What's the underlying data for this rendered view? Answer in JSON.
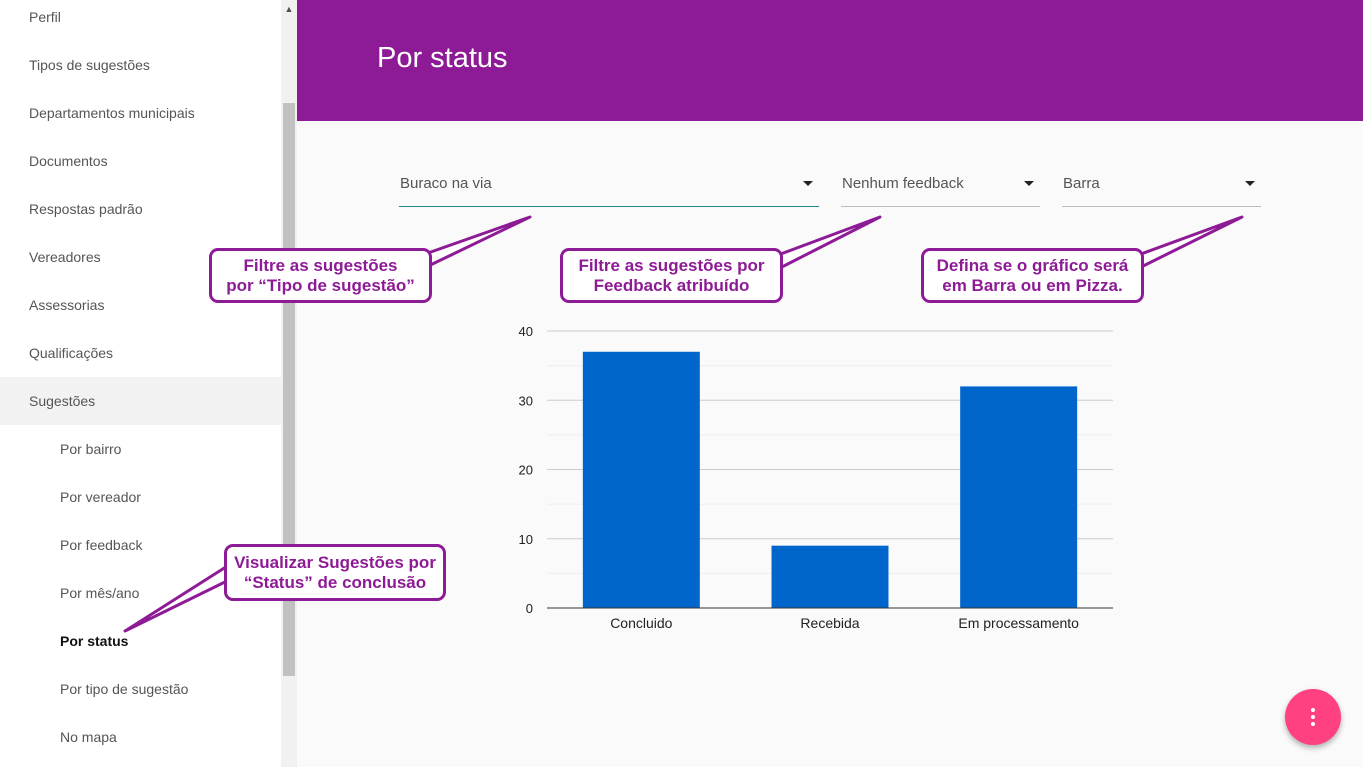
{
  "sidebar": {
    "items": [
      {
        "label": "Perfil"
      },
      {
        "label": "Tipos de sugestões"
      },
      {
        "label": "Departamentos municipais"
      },
      {
        "label": "Documentos"
      },
      {
        "label": "Respostas padrão"
      },
      {
        "label": "Vereadores"
      },
      {
        "label": "Assessorias"
      },
      {
        "label": "Qualificações"
      },
      {
        "label": "Sugestões"
      }
    ],
    "subitems": [
      {
        "label": "Por bairro"
      },
      {
        "label": "Por vereador"
      },
      {
        "label": "Por feedback"
      },
      {
        "label": "Por mês/ano"
      },
      {
        "label": "Por status"
      },
      {
        "label": "Por tipo de sugestão"
      },
      {
        "label": "No mapa"
      }
    ]
  },
  "header": {
    "title": "Por status",
    "color": "#8e1b96"
  },
  "filters": {
    "suggestion_type": "Buraco na via",
    "feedback": "Nenhum feedback",
    "chart_type": "Barra"
  },
  "callouts": {
    "type_filter": {
      "line1": "Filtre as sugestões",
      "line2": "por “Tipo de sugestão”"
    },
    "feedback_filter": {
      "line1": "Filtre as sugestões por",
      "line2": "Feedback atribuído"
    },
    "chart_type": {
      "line1": "Defina se o gráfico será",
      "line2": "em Barra ou em Pizza."
    },
    "status_view": {
      "line1": "Visualizar Sugestões por",
      "line2": "“Status” de conclusão"
    }
  },
  "chart_data": {
    "type": "bar",
    "categories": [
      "Concluido",
      "Recebida",
      "Em processamento"
    ],
    "values": [
      37,
      9,
      32
    ],
    "yticks": [
      "0",
      "10",
      "20",
      "30",
      "40"
    ],
    "ylim": [
      0,
      40
    ],
    "bar_color": "#0066cc",
    "grid": true
  },
  "fab": {
    "icon": "more-vert-icon",
    "color": "#ff4081"
  }
}
